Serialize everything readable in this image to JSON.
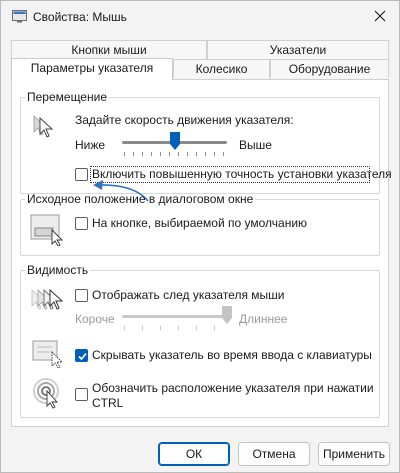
{
  "window": {
    "title": "Свойства: Мышь"
  },
  "tabs": {
    "row1": [
      "Кнопки мыши",
      "Указатели"
    ],
    "row2": [
      "Параметры указателя",
      "Колесико",
      "Оборудование"
    ],
    "active": "Параметры указателя"
  },
  "movement": {
    "title": "Перемещение",
    "speed_label": "Задайте скорость движения указателя:",
    "slow_label": "Ниже",
    "fast_label": "Выше",
    "speed_value": 0.5,
    "enhance_precision_label": "Включить повышенную точность установки указателя",
    "enhance_precision_checked": false
  },
  "snap_to": {
    "title": "Исходное положение в диалоговом окне",
    "label": "На кнопке, выбираемой по умолчанию",
    "checked": false
  },
  "visibility": {
    "title": "Видимость",
    "trails_label": "Отображать след указателя мыши",
    "trails_checked": false,
    "short_label": "Короче",
    "long_label": "Длиннее",
    "trail_length_value": 1.0,
    "hide_typing_label": "Скрывать указатель во время ввода с клавиатуры",
    "hide_typing_checked": true,
    "show_location_label_1": "Обозначить расположение указателя при нажатии",
    "show_location_label_2": "CTRL",
    "show_location_checked": false
  },
  "buttons": {
    "ok": "ОК",
    "cancel": "Отмена",
    "apply": "Применить"
  },
  "colors": {
    "accent": "#005fb8",
    "annotation_arrow": "#2f74c0"
  }
}
